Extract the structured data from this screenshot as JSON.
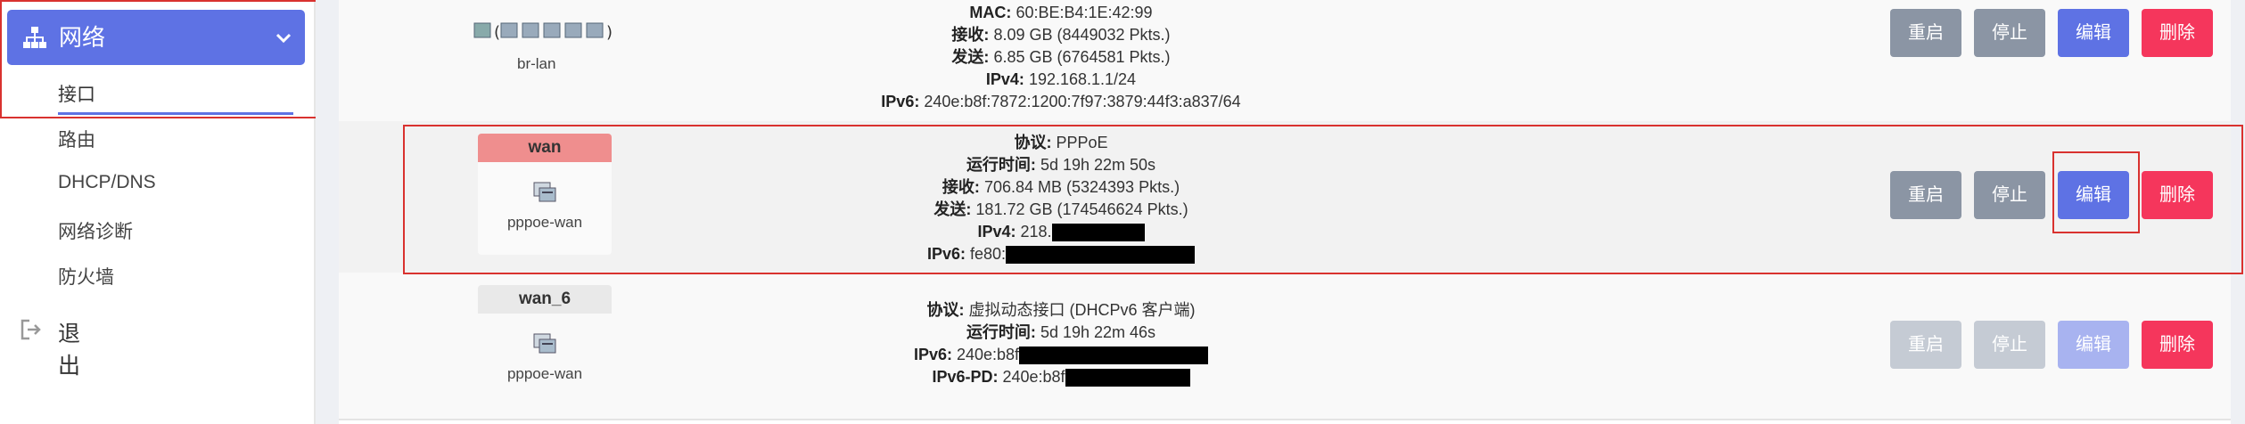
{
  "sidebar": {
    "network_label": "网络",
    "items": [
      {
        "label": "接口"
      },
      {
        "label": "路由"
      },
      {
        "label": "DHCP/DNS"
      },
      {
        "label": "网络诊断"
      },
      {
        "label": "防火墙"
      }
    ],
    "logout_label": "退出",
    "accent_color": "#5e72e4"
  },
  "buttons": {
    "restart": "重启",
    "stop": "停止",
    "edit": "编辑",
    "delete": "删除"
  },
  "interfaces": [
    {
      "device": "br-lan",
      "lines": [
        {
          "label": "MAC:",
          "value": "60:BE:B4:1E:42:99"
        },
        {
          "label": "接收:",
          "value": "8.09 GB (8449032 Pkts.)"
        },
        {
          "label": "发送:",
          "value": "6.85 GB (6764581 Pkts.)"
        },
        {
          "label": "IPv4:",
          "value": "192.168.1.1/24"
        },
        {
          "label": "IPv6:",
          "value": "240e:b8f:7872:1200:7f97:3879:44f3:a837/64"
        }
      ]
    },
    {
      "name": "wan",
      "device": "pppoe-wan",
      "lines": [
        {
          "label": "协议:",
          "value": "PPPoE"
        },
        {
          "label": "运行时间:",
          "value": "5d 19h 22m 50s"
        },
        {
          "label": "接收:",
          "value": "706.84 MB (5324393 Pkts.)"
        },
        {
          "label": "发送:",
          "value": "181.72 GB (174546624 Pkts.)"
        },
        {
          "label": "IPv4:",
          "value": "218."
        },
        {
          "label": "IPv6:",
          "value": "fe80:"
        }
      ]
    },
    {
      "name": "wan_6",
      "device": "pppoe-wan",
      "lines": [
        {
          "label": "协议:",
          "value": "虚拟动态接口 (DHCPv6 客户端)"
        },
        {
          "label": "运行时间:",
          "value": "5d 19h 22m 46s"
        },
        {
          "label": "IPv6:",
          "value": "240e:b8f"
        },
        {
          "label": "IPv6-PD:",
          "value": "240e:b8f"
        }
      ]
    }
  ],
  "colors": {
    "wan_badge": "#ef8e8e",
    "delete": "#f5365c",
    "neutral_button": "#8b95a4",
    "highlight": "#d9322f"
  }
}
